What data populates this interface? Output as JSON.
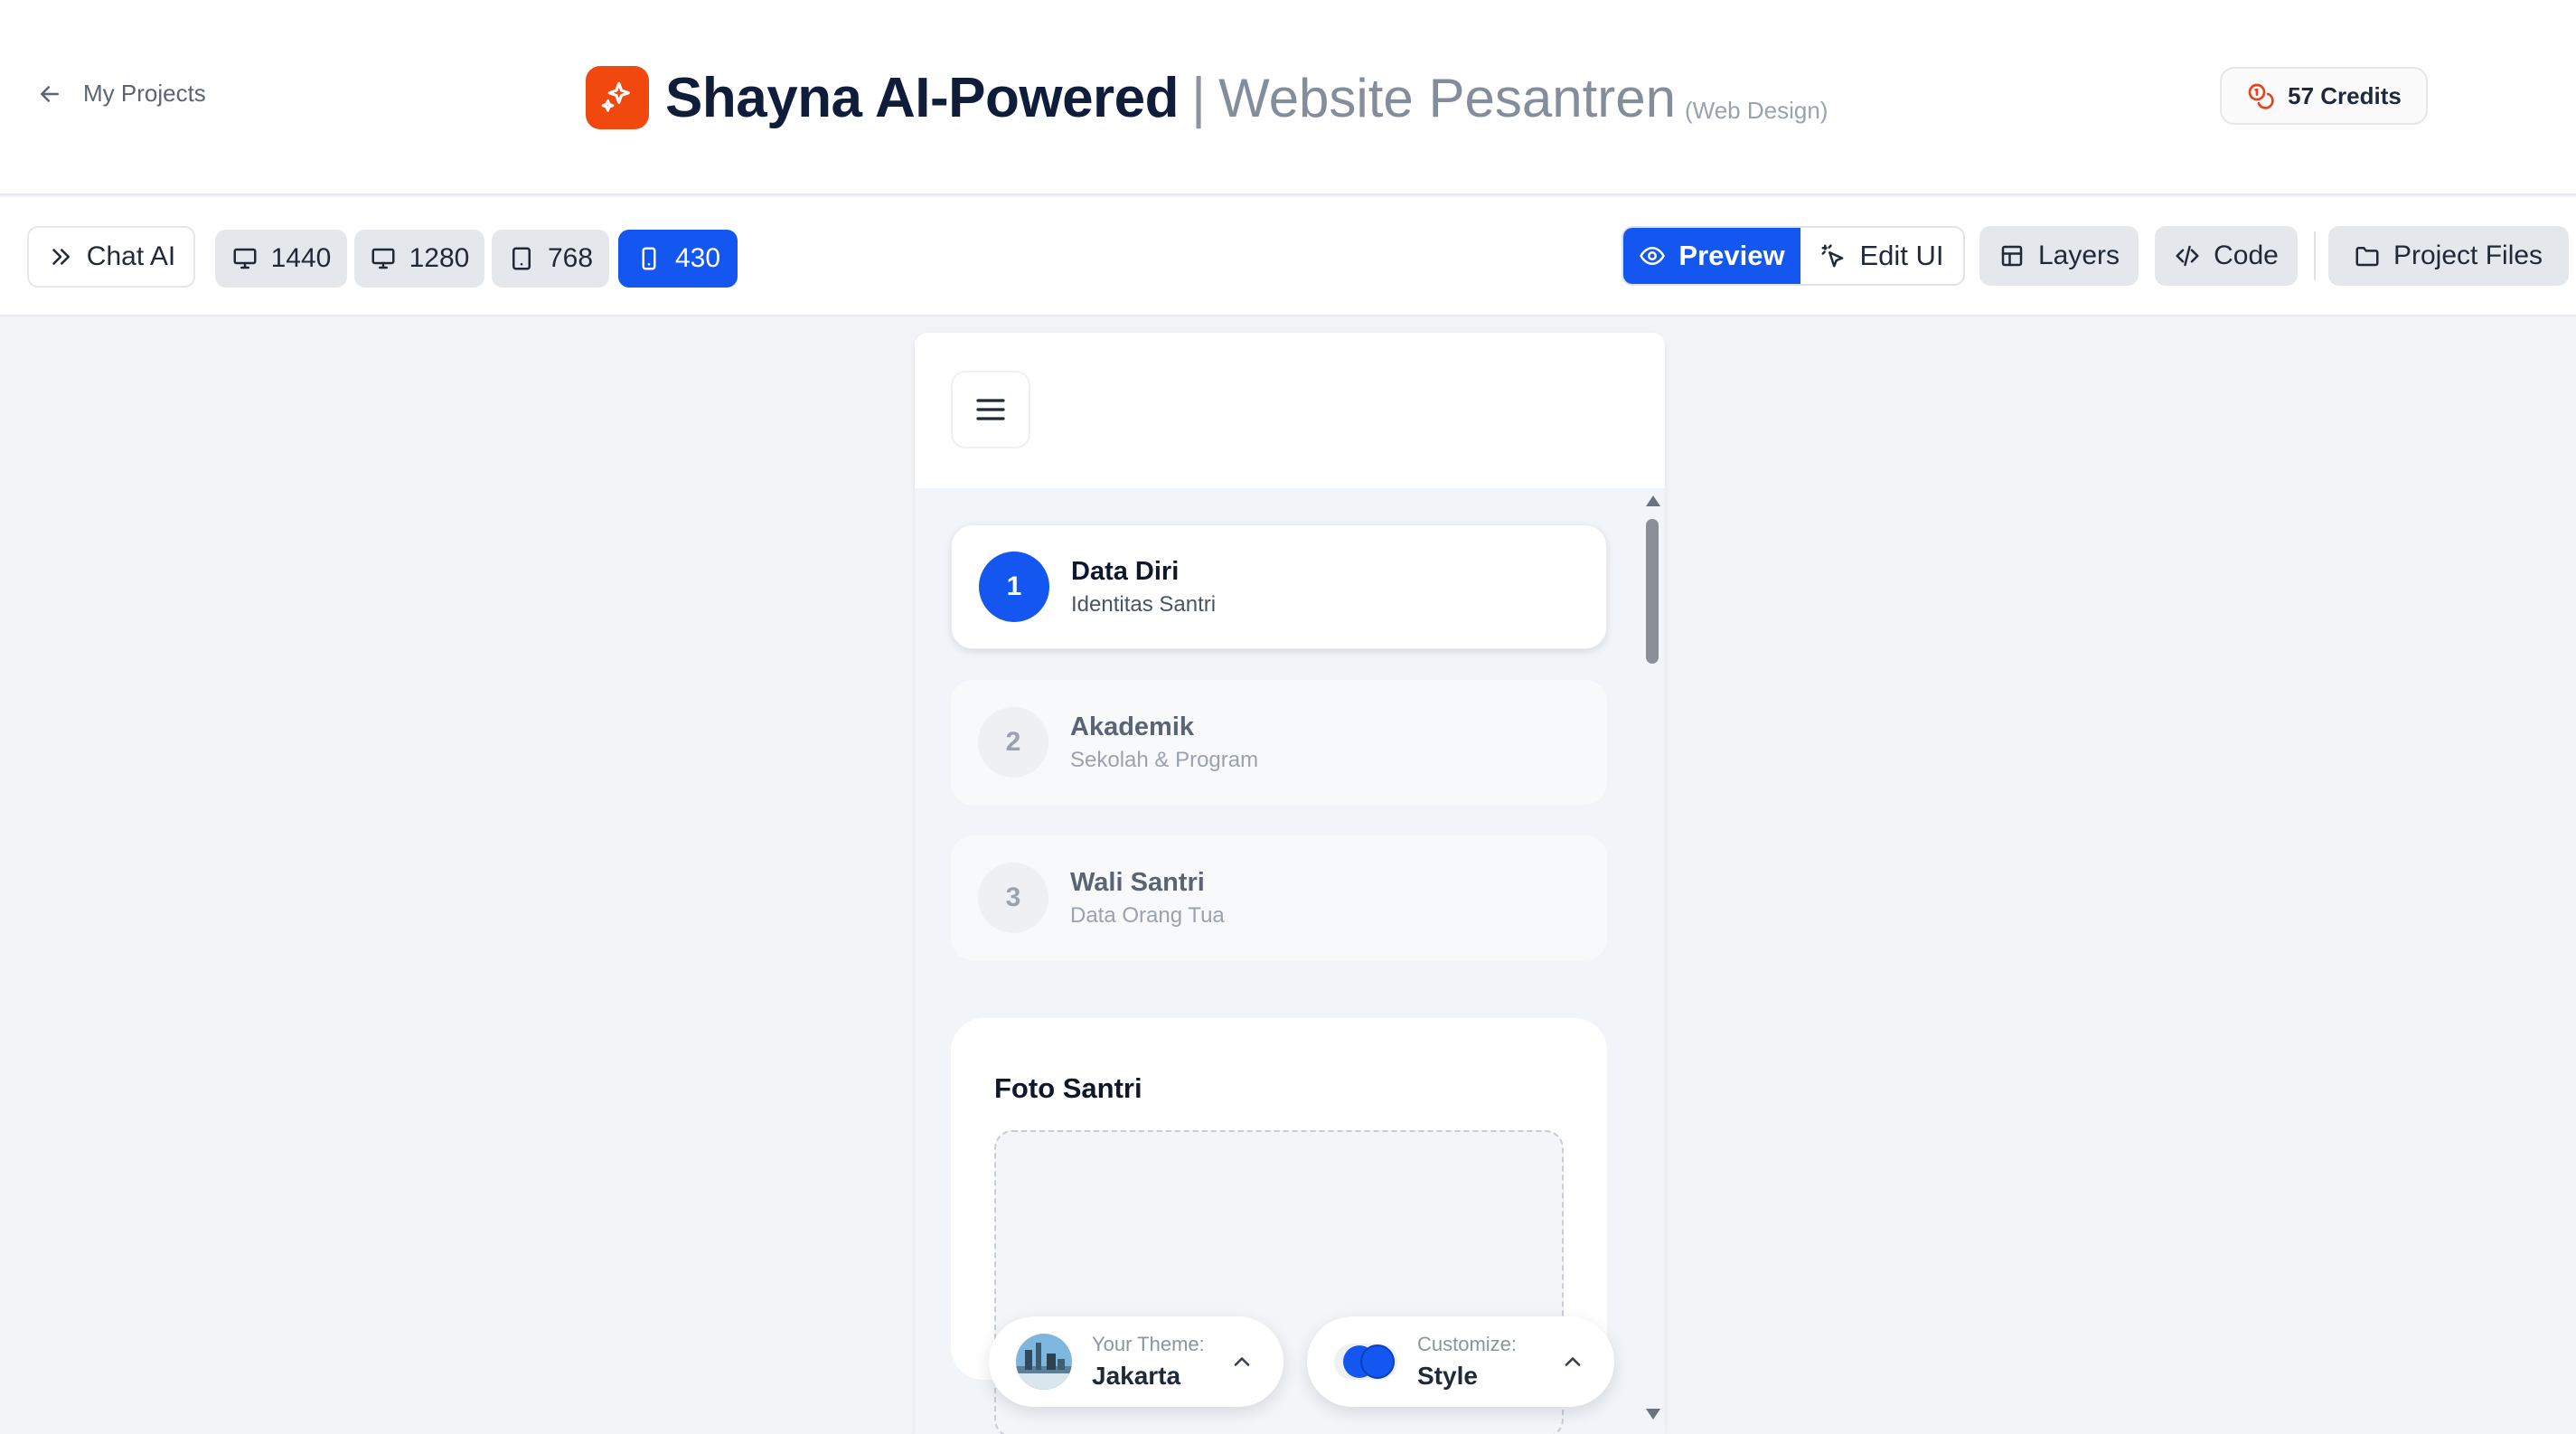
{
  "header": {
    "back_label": "My Projects",
    "title_main": "Shayna AI-Powered",
    "title_separator": "|",
    "title_sub": "Website Pesantren",
    "title_tag": "(Web Design)",
    "credits_label": "57 Credits",
    "logo_icon": "sparkles-icon",
    "colors": {
      "logo_bg": "#f0480f",
      "credits_icon": "#e8421a"
    }
  },
  "toolbar": {
    "chat_label": "Chat AI",
    "viewports": [
      {
        "label": "1440",
        "icon": "desktop-icon",
        "selected": false
      },
      {
        "label": "1280",
        "icon": "desktop-icon",
        "selected": false
      },
      {
        "label": "768",
        "icon": "tablet-icon",
        "selected": false
      },
      {
        "label": "430",
        "icon": "phone-icon",
        "selected": true
      }
    ],
    "preview_label": "Preview",
    "edit_label": "Edit UI",
    "layers_label": "Layers",
    "code_label": "Code",
    "project_files_label": "Project Files",
    "colors": {
      "accent": "#1456f0",
      "grey_button": "#e4e7ec"
    }
  },
  "preview": {
    "steps": [
      {
        "number": "1",
        "title": "Data Diri",
        "subtitle": "Identitas Santri",
        "active": true
      },
      {
        "number": "2",
        "title": "Akademik",
        "subtitle": "Sekolah & Program",
        "active": false
      },
      {
        "number": "3",
        "title": "Wali Santri",
        "subtitle": "Data Orang Tua",
        "active": false
      }
    ],
    "photo_card_title": "Foto Santri"
  },
  "floating": {
    "theme_label": "Your Theme:",
    "theme_value": "Jakarta",
    "customize_label": "Customize:",
    "customize_value": "Style"
  }
}
